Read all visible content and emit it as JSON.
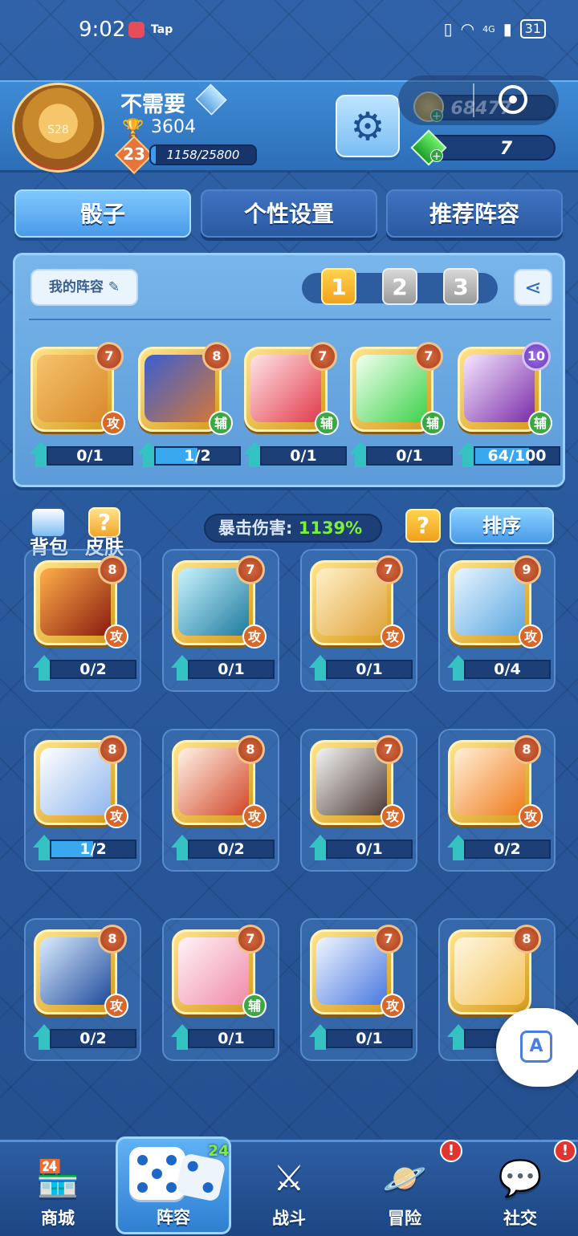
{
  "status_bar": {
    "time": "9:02",
    "app_label": "Tap",
    "network": "4G",
    "battery": "31"
  },
  "player": {
    "name": "不需要",
    "season_badge": "S28",
    "trophies": "3604",
    "level": "23",
    "xp_text": "1158/25800",
    "xp_fraction": 0.045
  },
  "currency": {
    "gold": "68477",
    "gems": "7"
  },
  "tabs": [
    "骰子",
    "个性设置",
    "推荐阵容"
  ],
  "loadout": {
    "my_lineup_label": "我的阵容",
    "presets": [
      "1",
      "2",
      "3"
    ],
    "active_preset": 0,
    "dice": [
      {
        "name": "ox-dice",
        "level": "7",
        "role": "攻",
        "progress": "0/1",
        "fill": 0.0,
        "colors": [
          "#f6c36c",
          "#d9892a"
        ]
      },
      {
        "name": "giraffe-dice",
        "level": "8",
        "role": "辅",
        "progress": "1/2",
        "fill": 0.5,
        "colors": [
          "#3a5fd0",
          "#d4773a"
        ]
      },
      {
        "name": "top-hat-dice",
        "level": "7",
        "role": "辅",
        "progress": "0/1",
        "fill": 0.0,
        "colors": [
          "#ffe5e8",
          "#e23a4a"
        ]
      },
      {
        "name": "healing-plus-dice",
        "level": "7",
        "role": "辅",
        "progress": "0/1",
        "fill": 0.0,
        "colors": [
          "#f3fff0",
          "#3cd24a"
        ]
      },
      {
        "name": "mask-dice",
        "level": "10",
        "role": "辅",
        "progress": "64/100",
        "fill": 0.64,
        "colors": [
          "#f6e6ff",
          "#7a2ca8"
        ]
      }
    ]
  },
  "crit": {
    "label": "暴击伤害:",
    "value": "1139%"
  },
  "actions": {
    "bag": "背包",
    "skin": "皮肤",
    "help": "?",
    "sort": "排序"
  },
  "collection": [
    {
      "name": "fire-slash-dice",
      "level": "8",
      "role": "攻",
      "progress": "0/2",
      "fill": 0.0,
      "colors": [
        "#ffb04a",
        "#8a1a10"
      ]
    },
    {
      "name": "whirlpool-dice",
      "level": "7",
      "role": "攻",
      "progress": "0/1",
      "fill": 0.0,
      "colors": [
        "#c9f4ff",
        "#1d7a9e"
      ]
    },
    {
      "name": "bull-dice",
      "level": "7",
      "role": "攻",
      "progress": "0/1",
      "fill": 0.0,
      "colors": [
        "#fff1c8",
        "#e0a23a"
      ]
    },
    {
      "name": "ice-sword-dice",
      "level": "9",
      "role": "攻",
      "progress": "0/4",
      "fill": 0.0,
      "colors": [
        "#e8f6ff",
        "#5aa5e0"
      ]
    },
    {
      "name": "frost-sword-dice",
      "level": "8",
      "role": "攻",
      "progress": "1/2",
      "fill": 0.5,
      "colors": [
        "#ffffff",
        "#8fb6ee"
      ]
    },
    {
      "name": "war-banner-dice",
      "level": "8",
      "role": "攻",
      "progress": "0/2",
      "fill": 0.0,
      "colors": [
        "#fff4e6",
        "#d2452a"
      ]
    },
    {
      "name": "volcano-dice",
      "level": "7",
      "role": "攻",
      "progress": "0/1",
      "fill": 0.0,
      "colors": [
        "#f4f4f4",
        "#4a3a34"
      ]
    },
    {
      "name": "pumpkin-witch-dice",
      "level": "8",
      "role": "攻",
      "progress": "0/2",
      "fill": 0.0,
      "colors": [
        "#fff0d8",
        "#f07a1a"
      ]
    },
    {
      "name": "moon-maiden-dice",
      "level": "8",
      "role": "攻",
      "progress": "0/2",
      "fill": 0.0,
      "colors": [
        "#d9ecff",
        "#1f4a9a"
      ]
    },
    {
      "name": "cherry-blossom-dice",
      "level": "7",
      "role": "辅",
      "progress": "0/1",
      "fill": 0.0,
      "colors": [
        "#fff4f8",
        "#f08aa8"
      ]
    },
    {
      "name": "star-dice",
      "level": "7",
      "role": "攻",
      "progress": "0/1",
      "fill": 0.0,
      "colors": [
        "#eef6ff",
        "#4a78e0"
      ]
    },
    {
      "name": "lucky-cat-dice",
      "level": "8",
      "role": "",
      "progress": "0/",
      "fill": 0.0,
      "colors": [
        "#fff7e0",
        "#f3c25a"
      ]
    }
  ],
  "nav": [
    {
      "name": "shop",
      "label": "商城",
      "icon": "store-icon"
    },
    {
      "name": "lineup",
      "label": "阵容",
      "icon": "dice-icon",
      "badge": "24"
    },
    {
      "name": "battle",
      "label": "战斗",
      "icon": "crossed-swords-icon"
    },
    {
      "name": "adventure",
      "label": "冒险",
      "icon": "planet-icon",
      "alert": "!"
    },
    {
      "name": "social",
      "label": "社交",
      "icon": "chat-bubbles-icon",
      "alert": "!"
    }
  ]
}
